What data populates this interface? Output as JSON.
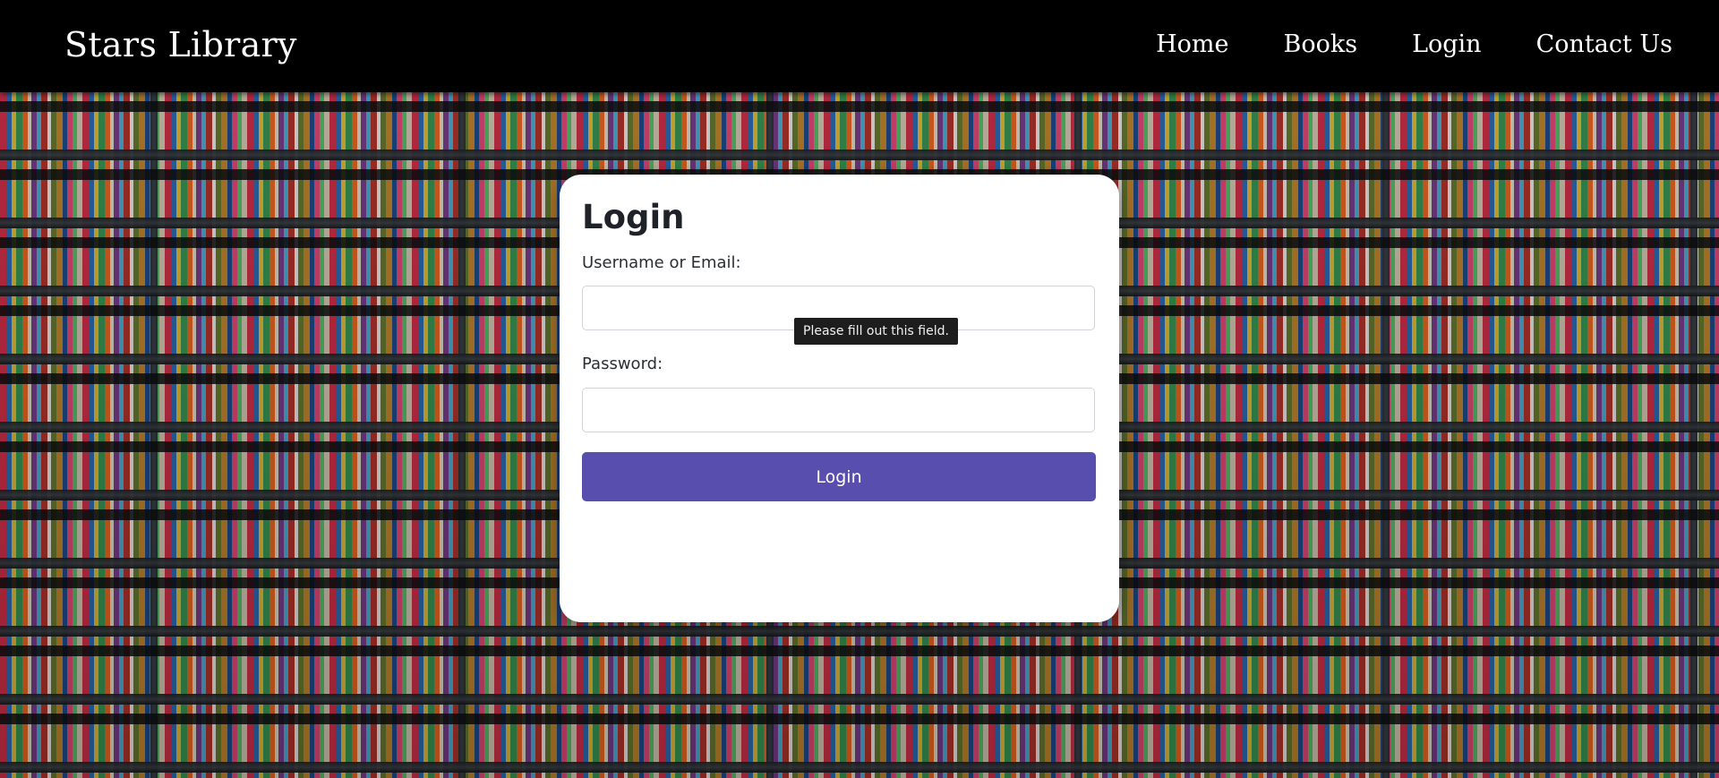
{
  "navbar": {
    "brand": "Stars Library",
    "links": [
      {
        "label": "Home"
      },
      {
        "label": "Books"
      },
      {
        "label": "Login"
      },
      {
        "label": "Contact Us"
      }
    ]
  },
  "login_form": {
    "title": "Login",
    "username_label": "Username or Email:",
    "username_value": "",
    "password_label": "Password:",
    "password_value": "",
    "submit_label": "Login",
    "validation_tooltip": "Please fill out this field."
  },
  "colors": {
    "navbar_background": "#000000",
    "button_accent": "#574ead",
    "card_background": "#ffffff",
    "tooltip_background": "#1d1d1d"
  },
  "background": {
    "image": "bookshelf-pattern"
  }
}
